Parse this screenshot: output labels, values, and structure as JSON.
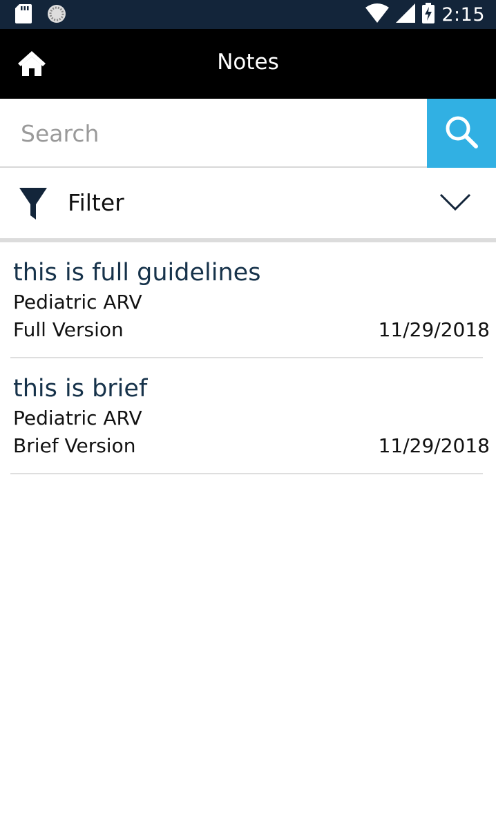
{
  "status_bar": {
    "time": "2:15",
    "icons": [
      "sd-card-icon",
      "sync-icon",
      "wifi-icon",
      "signal-icon",
      "battery-charging-icon"
    ]
  },
  "app_bar": {
    "title": "Notes",
    "home_icon": "home-icon"
  },
  "search": {
    "placeholder": "Search",
    "value": "",
    "button_icon": "search-icon",
    "accent_color": "#31b0e3"
  },
  "filter": {
    "label": "Filter",
    "icon": "funnel-icon",
    "expand_icon": "chevron-down-icon"
  },
  "notes": [
    {
      "title": "this is full guidelines",
      "category": "Pediatric ARV",
      "version": "Full Version",
      "date": "11/29/2018"
    },
    {
      "title": "this is brief",
      "category": "Pediatric ARV",
      "version": "Brief Version",
      "date": "11/29/2018"
    }
  ]
}
